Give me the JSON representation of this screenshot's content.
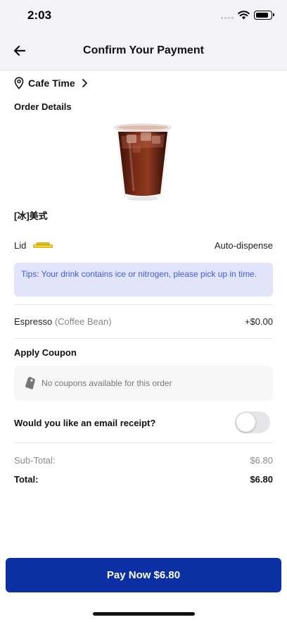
{
  "status_bar": {
    "time": "2:03"
  },
  "header": {
    "title": "Confirm Your Payment"
  },
  "store": {
    "name": "Cafe Time"
  },
  "order": {
    "section_title": "Order Details",
    "product_name": "[冰]美式",
    "lid_label": "Lid",
    "lid_value": "Auto-dispense",
    "tip": "Tips: Your drink contains ice or nitrogen, please pick up in time.",
    "addon_name": "Espresso",
    "addon_option": "(Coffee Bean)",
    "addon_price": "+$0.00"
  },
  "coupon": {
    "section_title": "Apply Coupon",
    "text": "No coupons available for this order"
  },
  "receipt": {
    "label": "Would you like an email receipt?",
    "enabled": false
  },
  "summary": {
    "subtotal_label": "Sub-Total:",
    "subtotal_value": "$6.80",
    "total_label": "Total:",
    "total_value": "$6.80"
  },
  "pay_button": {
    "label": "Pay Now $6.80"
  },
  "colors": {
    "primary": "#0c2fa4",
    "tip_background": "#e2e4fb",
    "tip_text": "#3c5fd6",
    "lid_icon": "#e8c20f"
  },
  "icons": {
    "back": "arrow-left-icon",
    "location": "location-pin-icon",
    "chevron": "chevron-right-icon",
    "lid": "lid-icon",
    "coupon": "coupon-tag-icon"
  }
}
